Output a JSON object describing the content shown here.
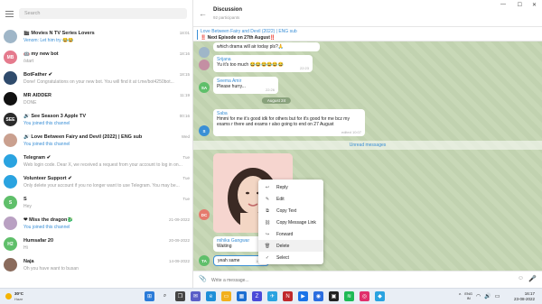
{
  "sidebar": {
    "search_placeholder": "Search",
    "chats": [
      {
        "name": "🎬 Movies N TV Series Lovers",
        "preview": "Venom: Let him try 😂😂",
        "time": "18:01",
        "avatar": "",
        "avatar_color": "#9fb6c8",
        "blue": true
      },
      {
        "name": "🤖 my new bot",
        "preview": "/start",
        "time": "18:16",
        "avatar": "MB",
        "avatar_color": "#e57a8d",
        "blue": false
      },
      {
        "name": "BotFather ✔",
        "preview": "Done! Congratulations on your new bot. You will find it at t.me/bot4250bot...",
        "time": "18:15",
        "avatar": "",
        "avatar_color": "#2f4b6c",
        "blue": false
      },
      {
        "name": "MR AIDDER",
        "preview": "DONE",
        "time": "11:19",
        "avatar": "",
        "avatar_color": "#111111",
        "blue": false
      },
      {
        "name": "🔊 See Season 3 Apple TV",
        "preview": "You joined this channel",
        "time": "00:16",
        "avatar": "SEE",
        "avatar_color": "#2b2b2b",
        "blue": true
      },
      {
        "name": "🔊 Love Between Fairy and Devil (2022) | ENG sub",
        "preview": "You joined this channel",
        "time": "Wed",
        "avatar": "",
        "avatar_color": "#caa08f",
        "blue": true
      },
      {
        "name": "Telegram ✔",
        "preview": "Web login code. Dear X, we received a request from your account to log in on...",
        "time": "Tue",
        "avatar": "",
        "avatar_color": "#2aa3e0",
        "blue": false
      },
      {
        "name": "Volunteer Support ✔",
        "preview": "Only delete your account if you no longer want to use Telegram. You may be...",
        "time": "Tue",
        "avatar": "",
        "avatar_color": "#2aa3e0",
        "blue": false
      },
      {
        "name": "S",
        "preview": "Hey",
        "time": "Tue",
        "avatar": "S",
        "avatar_color": "#5fbf6a",
        "blue": false
      },
      {
        "name": "❤ Miss the dragon🐉",
        "preview": "You joined this channel",
        "time": "21-09-2022",
        "avatar": "",
        "avatar_color": "#b9a0c2",
        "blue": true
      },
      {
        "name": "Humsafar 20",
        "preview": "Hi",
        "time": "20-09-2022",
        "avatar": "H2",
        "avatar_color": "#5fbf6a",
        "blue": false
      },
      {
        "name": "Naja",
        "preview": "Oh you have want to busan",
        "time": "14-09-2022",
        "avatar": "",
        "avatar_color": "#8a6b5c",
        "blue": false
      }
    ]
  },
  "chat": {
    "title": "Discussion",
    "subtitle": "92 participants",
    "pinned_title": "Love Between Fairy and Devil (2022) | ENG sub",
    "pinned_text": "‼️ Next Episode on 27th August‼️",
    "messages": [
      {
        "sender": "",
        "text": "which drama will air today pls?🙏",
        "time": "",
        "avatar": "",
        "avatar_color": "#9fb6c8"
      },
      {
        "sender": "Srijana",
        "text": "Yu it's too much 😂😂😂😂😂😂",
        "time": "22:23",
        "avatar": "",
        "avatar_color": "#c48fa3"
      },
      {
        "sender": "Seema Amir",
        "text": "Please hurry...",
        "time": "22:26",
        "avatar": "SA",
        "avatar_color": "#5fbf6a"
      },
      {
        "sender": "Saba",
        "text": "Hmmi for me it's good idk for others but for it's good for me bcz my exams r there and exams r also going to end on 27 August",
        "time": "edited 10:07",
        "avatar": "S",
        "avatar_color": "#3a8fd6"
      },
      {
        "sender": "mihika Gangwar",
        "text": "Waiting",
        "time": "",
        "avatar": "MG",
        "avatar_color": "#5fbf6a"
      },
      {
        "sender": "",
        "text": "yeah same",
        "time": "16:17",
        "avatar": "TA",
        "avatar_color": "#5fbf6a"
      }
    ],
    "photo_sender_avatar": "DC",
    "photo_sender_color": "#e57a6d",
    "date_label": "August 24",
    "unread_label": "Unread messages",
    "composer_placeholder": "Write a message..."
  },
  "context_menu": [
    {
      "label": "Reply",
      "icon": "↩"
    },
    {
      "label": "Edit",
      "icon": "✎"
    },
    {
      "label": "Copy Text",
      "icon": "⧉"
    },
    {
      "label": "Copy Message Link",
      "icon": "⛓"
    },
    {
      "label": "Forward",
      "icon": "↪"
    },
    {
      "label": "Delete",
      "icon": "🗑"
    },
    {
      "label": "Select",
      "icon": "✓"
    }
  ],
  "taskbar": {
    "weather_temp": "30°C",
    "weather_desc": "Haze",
    "lang_1": "ENG",
    "lang_2": "IN",
    "time": "16:17",
    "date": "23-08-2022"
  }
}
